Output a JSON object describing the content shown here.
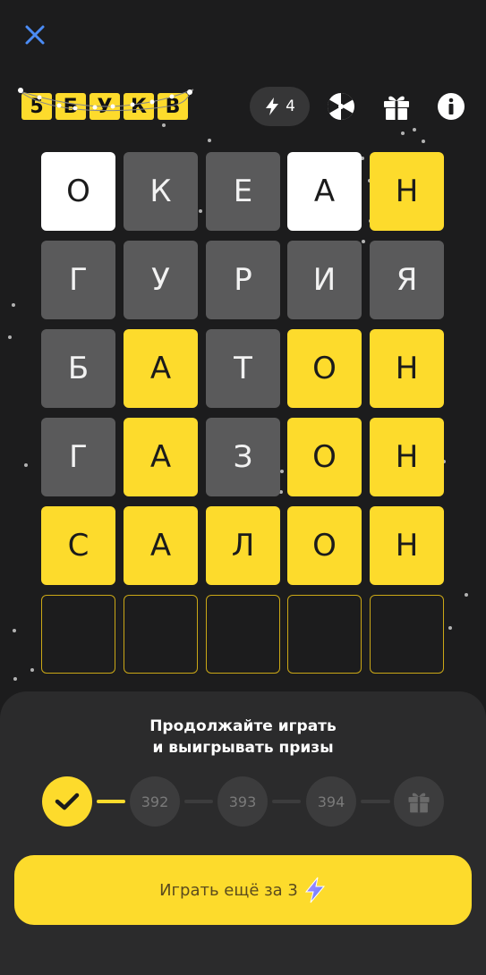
{
  "header": {
    "logo_tiles": [
      "5",
      "Б",
      "У",
      "К",
      "В"
    ],
    "energy_count": "4",
    "icons": [
      "close-icon",
      "lightning-icon",
      "wheel-icon",
      "gift-icon",
      "info-icon"
    ]
  },
  "board": {
    "rows": [
      {
        "letters": [
          "О",
          "К",
          "Е",
          "А",
          "Н"
        ],
        "states": [
          "white",
          "gray",
          "gray",
          "white",
          "yellow"
        ]
      },
      {
        "letters": [
          "Г",
          "У",
          "Р",
          "И",
          "Я"
        ],
        "states": [
          "gray",
          "gray",
          "gray",
          "gray",
          "gray"
        ]
      },
      {
        "letters": [
          "Б",
          "А",
          "Т",
          "О",
          "Н"
        ],
        "states": [
          "gray",
          "yellow",
          "gray",
          "yellow",
          "yellow"
        ]
      },
      {
        "letters": [
          "Г",
          "А",
          "З",
          "О",
          "Н"
        ],
        "states": [
          "gray",
          "yellow",
          "gray",
          "yellow",
          "yellow"
        ]
      },
      {
        "letters": [
          "С",
          "А",
          "Л",
          "О",
          "Н"
        ],
        "states": [
          "yellow",
          "yellow",
          "yellow",
          "yellow",
          "yellow"
        ]
      },
      {
        "letters": [
          "",
          "",
          "",
          "",
          ""
        ],
        "states": [
          "empty",
          "empty",
          "empty",
          "empty",
          "empty"
        ]
      }
    ]
  },
  "sheet": {
    "title_line1": "Продолжайте играть",
    "title_line2": "и выигрывать призы",
    "steps": [
      "392",
      "393",
      "394"
    ],
    "play_button": "Играть ещё за 3"
  },
  "colors": {
    "background": "#1c1c1d",
    "accent": "#fddb2c",
    "tile_gray": "#5a5a5b",
    "tile_white": "#ffffff",
    "sheet": "#2b2b2c",
    "close": "#4b8cf5"
  }
}
